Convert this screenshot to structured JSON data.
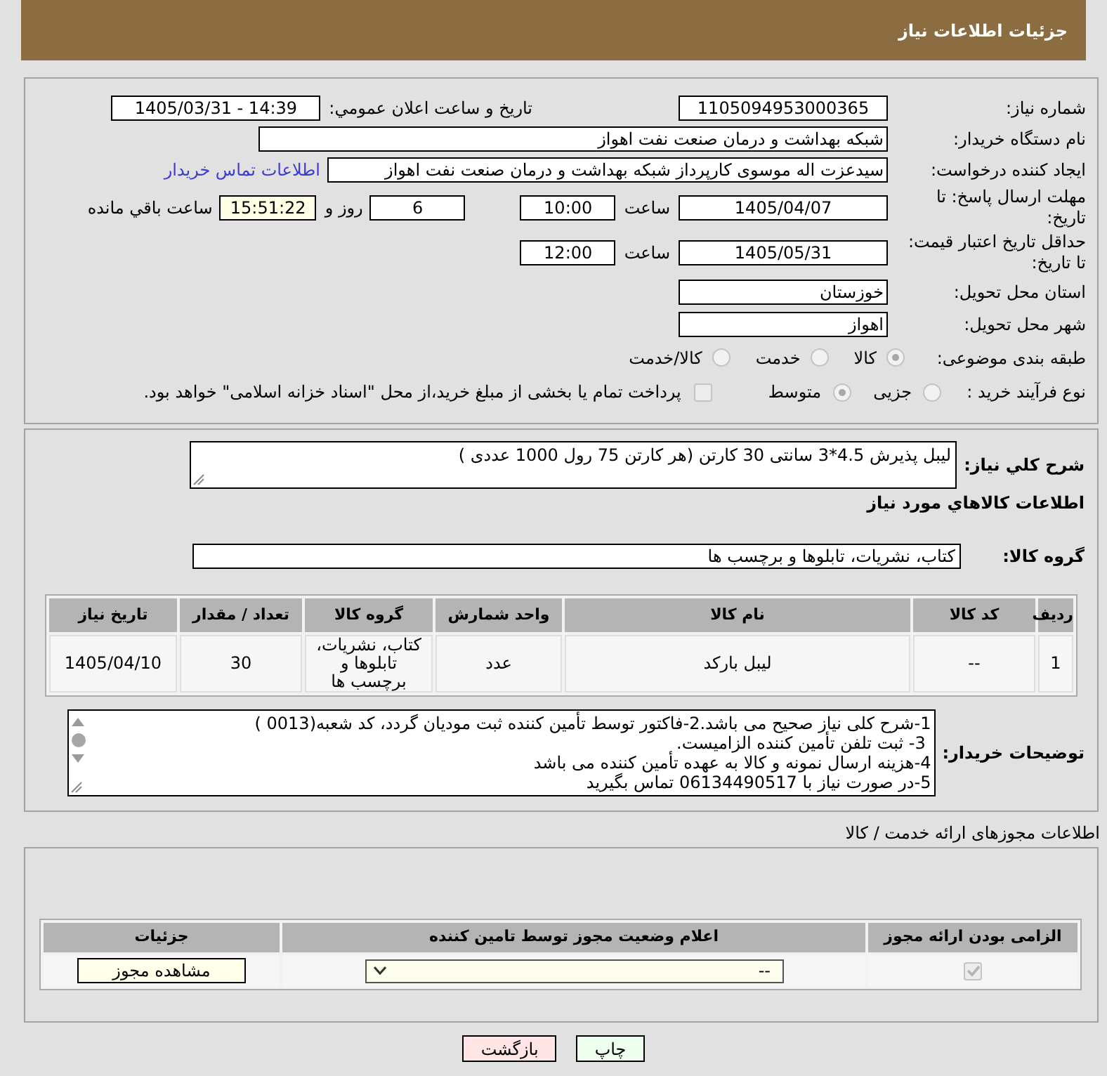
{
  "header": {
    "title": "جزئیات اطلاعات نیاز"
  },
  "need_details": {
    "need_number": {
      "label": "شماره نیاز:",
      "value": "1105094953000365"
    },
    "announcement": {
      "label": "تاریخ و ساعت اعلان عمومي:",
      "value": "1405/03/31 - 14:39"
    },
    "buyer_organization": {
      "label": "نام دستگاه خریدار:",
      "value": "شبکه بهداشت و درمان صنعت نفت اهواز"
    },
    "requester": {
      "label": "ایجاد کننده درخواست:",
      "value": "سیدعزت اله موسوی کارپرداز شبکه بهداشت و درمان صنعت نفت اهواز",
      "contact_link": "اطلاعات تماس خریدار"
    },
    "response_deadline": {
      "label": "مهلت ارسال پاسخ: تا تاریخ:",
      "date": "1405/04/07",
      "time_label": "ساعت",
      "time": "10:00",
      "days": "6",
      "days_label": "روز و",
      "remaining_time": "15:51:22",
      "remaining_label": "ساعت باقي مانده"
    },
    "price_validity": {
      "label": "حداقل تاریخ اعتبار قیمت: تا تاریخ:",
      "date": "1405/05/31",
      "time_label": "ساعت",
      "time": "12:00"
    },
    "delivery_province": {
      "label": "استان محل تحویل:",
      "value": "خوزستان"
    },
    "delivery_city": {
      "label": "شهر محل تحویل:",
      "value": "اهواز"
    },
    "subject_category": {
      "label": "طبقه بندی موضوعی:",
      "options": [
        {
          "label": "کالا",
          "selected": true,
          "disabled": true
        },
        {
          "label": "خدمت",
          "selected": false,
          "disabled": true
        },
        {
          "label": "کالا/خدمت",
          "selected": false,
          "disabled": true
        }
      ]
    },
    "purchase_process": {
      "label": "نوع فرآیند خرید :",
      "options": [
        {
          "label": "جزیی",
          "selected": false,
          "disabled": true
        },
        {
          "label": "متوسط",
          "selected": true,
          "disabled": true
        }
      ],
      "treasury_payment": {
        "label": "پرداخت تمام یا بخشی از مبلغ خرید،از محل \"اسناد خزانه اسلامی\" خواهد بود.",
        "checked": false,
        "disabled": true
      }
    }
  },
  "items_section": {
    "description": {
      "label": "شرح کلي نیاز:",
      "value": "لیبل پذیرش 4.5*3 سانتی 30 کارتن (هر کارتن 75 رول 1000 عددی )"
    },
    "heading": "اطلاعات کالاهاي مورد نیاز",
    "goods_group": {
      "label": "گروه کالا:",
      "value": "کتاب، نشریات، تابلوها و برچسب ها"
    },
    "table": {
      "columns": [
        "ردیف",
        "کد کالا",
        "نام کالا",
        "واحد شمارش",
        "گروه کالا",
        "تعداد / مقدار",
        "تاریخ نیاز"
      ],
      "rows": [
        [
          "1",
          "--",
          "لیبل بارکد",
          "عدد",
          "کتاب، نشریات، تابلوها و برچسب ها",
          "30",
          "1405/04/10"
        ]
      ]
    },
    "buyer_notes": {
      "label": "توضیحات خریدار:",
      "lines": [
        "1-شرح کلی نیاز صحیح می باشد.2-فاکتور توسط تأمین کننده ثبت مودیان گردد، کد شعبه(0013 )",
        " 3- ثبت تلفن تأمین کننده الزامیست.",
        "4-هزینه ارسال نمونه و کالا به عهده تأمین کننده می باشد",
        "5-در صورت نیاز با 06134490517 تماس بگیرید"
      ]
    }
  },
  "permits_section": {
    "title": "اطلاعات مجوزهای ارائه خدمت / کالا",
    "table": {
      "columns": [
        "الزامی بودن ارائه مجوز",
        "اعلام وضعیت مجوز توسط تامین کننده",
        "جزئیات"
      ],
      "rows": [
        {
          "required": {
            "checked": true,
            "disabled": true
          },
          "status": {
            "value": "--"
          },
          "details_button": "مشاهده مجوز"
        }
      ]
    }
  },
  "actions": [
    {
      "kind": "print",
      "label": "چاپ"
    },
    {
      "kind": "back",
      "label": "بازگشت"
    }
  ]
}
